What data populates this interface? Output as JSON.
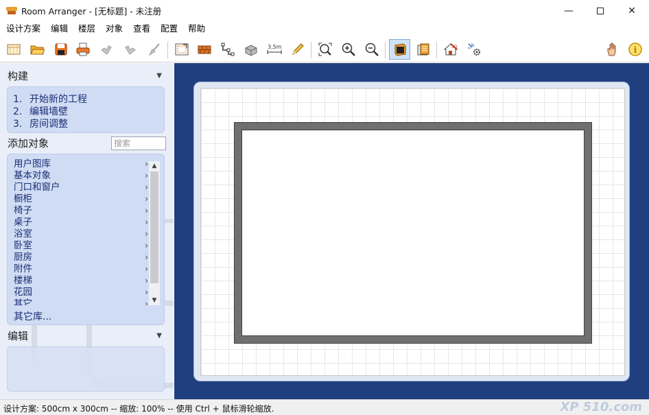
{
  "window": {
    "title": "Room Arranger - [无标题] - 未注册",
    "minimize": "—",
    "close": "✕"
  },
  "menu": [
    "设计方案",
    "编辑",
    "楼层",
    "对象",
    "查看",
    "配置",
    "帮助"
  ],
  "toolbar": {
    "icons": [
      "new-document-icon",
      "open-folder-icon",
      "save-icon",
      "print-icon",
      "undo-icon",
      "redo-icon",
      "clean-brush-icon",
      "room-setup-icon",
      "wall-icon",
      "polyline-icon",
      "3d-object-icon",
      "dimension-icon",
      "pencil-icon",
      "zoom-fit-icon",
      "zoom-in-icon",
      "zoom-out-icon",
      "2d-view-icon",
      "floors-icon",
      "3d-view-icon",
      "3d-settings-icon",
      "hand-tool-icon",
      "info-icon"
    ],
    "dimension_label": "3,5m"
  },
  "left_panel": {
    "build": {
      "title": "构建",
      "arrow": "▼",
      "steps": [
        {
          "num": "1.",
          "label": "开始新的工程"
        },
        {
          "num": "2.",
          "label": "编辑墙壁"
        },
        {
          "num": "3.",
          "label": "房间调整"
        }
      ]
    },
    "add_objects": {
      "title": "添加对象",
      "search_placeholder": "搜索",
      "items": [
        "用户图库",
        "基本对象",
        "门口和窗户",
        "橱柜",
        "椅子",
        "桌子",
        "浴室",
        "卧室",
        "厨房",
        "附件",
        "楼梯",
        "花园",
        "其它"
      ],
      "chevron": "›",
      "more": "其它库..."
    },
    "edit": {
      "title": "编辑",
      "arrow": "▼"
    }
  },
  "status": {
    "text": "设计方案: 500cm x 300cm -- 缩放: 100% -- 使用 Ctrl + 鼠标滑轮缩放.",
    "watermark": "XP 510.com"
  },
  "colors": {
    "canvas_bg": "#1f3f7f",
    "panel_bg": "#e9eef8",
    "box_bg": "#cfdcf3",
    "link_text": "#1b2e75",
    "wall": "#707070"
  }
}
